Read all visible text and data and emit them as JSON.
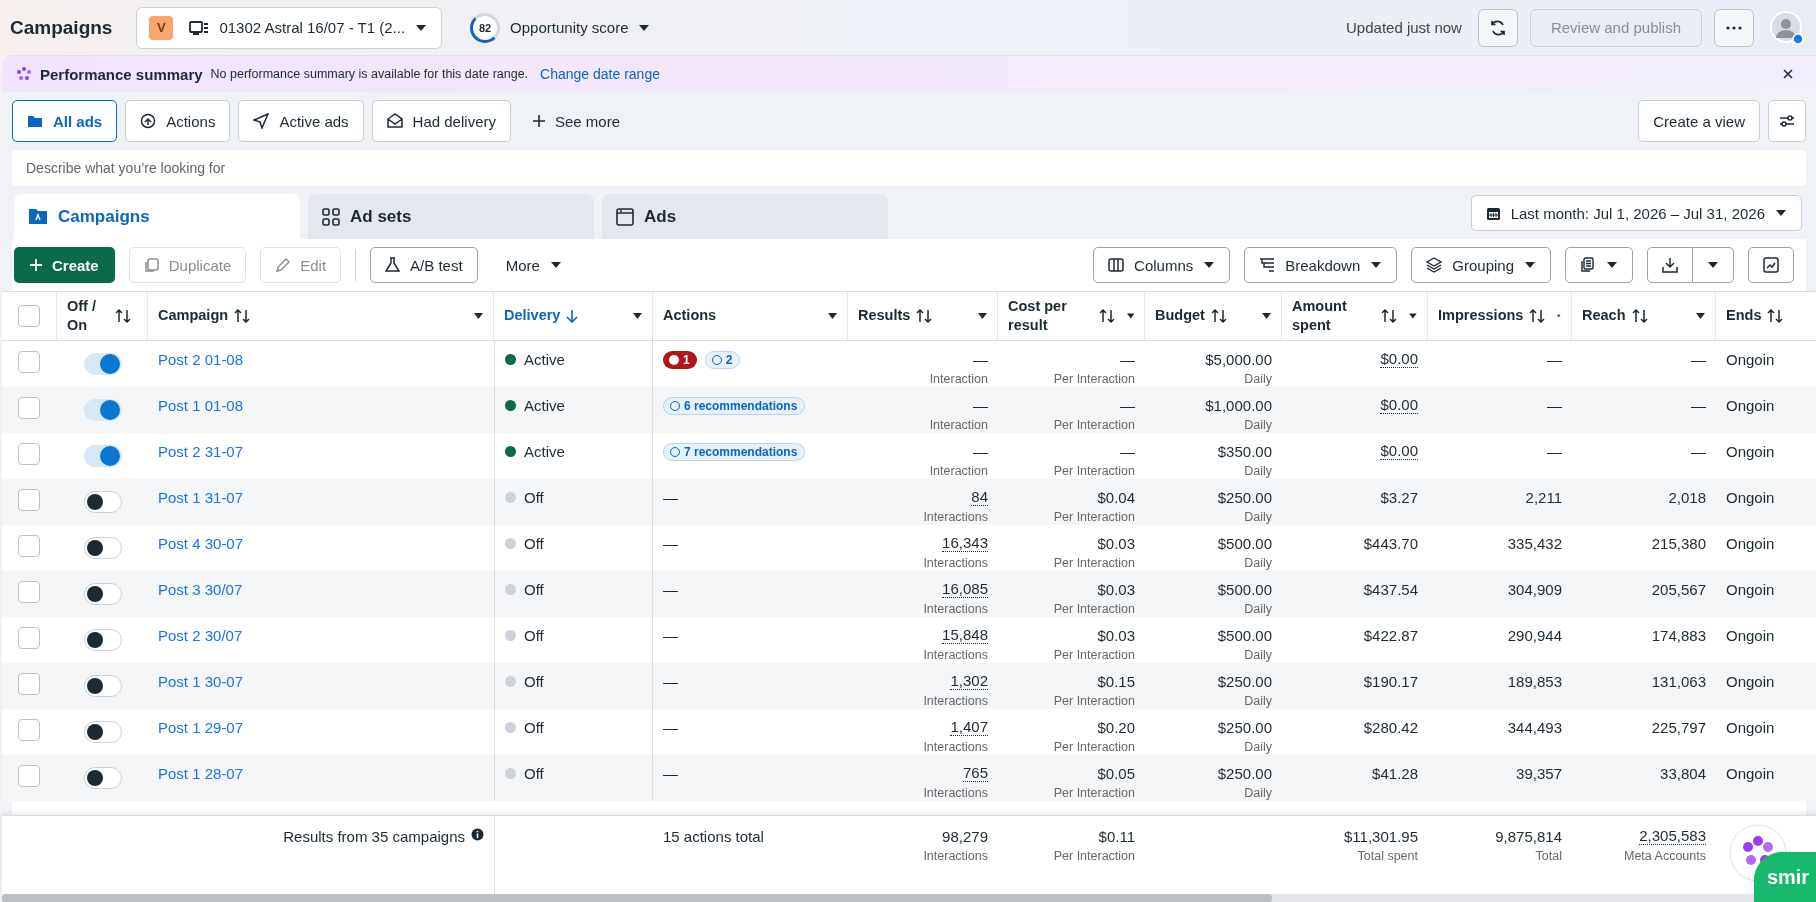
{
  "header": {
    "title": "Campaigns",
    "account": {
      "badge": "V",
      "name": "01302 Astral 16/07 - T1 (2..."
    },
    "score": {
      "value": "82",
      "label": "Opportunity score"
    },
    "status": "Updated just now",
    "publish": {
      "label": "Review and publish",
      "disabled": true
    }
  },
  "banner": {
    "title": "Performance summary",
    "message": "No performance summary is available for this date range.",
    "link": "Change date range"
  },
  "filters": [
    {
      "label": "All ads",
      "selected": true,
      "kind": "folder"
    },
    {
      "label": "Actions",
      "selected": false,
      "kind": "up"
    },
    {
      "label": "Active ads",
      "selected": false,
      "kind": "send"
    },
    {
      "label": "Had delivery",
      "selected": false,
      "kind": "mail"
    }
  ],
  "see_more": "See more",
  "create_view": "Create a view",
  "search": {
    "placeholder": "Describe what you’re looking for"
  },
  "level_tabs": [
    {
      "label": "Campaigns",
      "selected": true,
      "kind": "folder"
    },
    {
      "label": "Ad sets",
      "selected": false,
      "kind": "grid"
    },
    {
      "label": "Ads",
      "selected": false,
      "kind": "window"
    }
  ],
  "date_range": "Last month: Jul 1, 2026 – Jul 31, 2026",
  "toolbar": {
    "create": "Create",
    "duplicate": {
      "label": "Duplicate",
      "disabled": true
    },
    "edit": {
      "label": "Edit",
      "disabled": true
    },
    "ab_test": "A/B test",
    "more": "More",
    "columns": "Columns",
    "breakdown": "Breakdown",
    "grouping": "Grouping"
  },
  "table": {
    "all_checked": false,
    "columns": [
      {
        "label": "Off / On",
        "selected": false
      },
      {
        "label": "Campaign",
        "selected": false
      },
      {
        "label": "Delivery",
        "selected": true
      },
      {
        "label": "Actions",
        "selected": false
      },
      {
        "label": "Results",
        "selected": false
      },
      {
        "label": "Cost per result",
        "selected": false
      },
      {
        "label": "Budget",
        "selected": false
      },
      {
        "label": "Amount spent",
        "selected": false
      },
      {
        "label": "Impressions",
        "selected": false
      },
      {
        "label": "Reach",
        "selected": false
      },
      {
        "label": "Ends",
        "selected": false
      }
    ],
    "rows": [
      {
        "checked": false,
        "on": true,
        "name": "Post 2 01-08",
        "delivery": "Active",
        "delivery_active": true,
        "actions": [
          {
            "kind": "error",
            "text": "1"
          },
          {
            "kind": "rec",
            "text": "2"
          }
        ],
        "results": "—",
        "results_sub": "Interaction",
        "results_dotted": false,
        "cost": "—",
        "cost_sub": "Per Interaction",
        "budget": "$5,000.00",
        "budget_sub": "Daily",
        "amount": "$0.00",
        "amount_dotted": true,
        "impressions": "—",
        "reach": "—",
        "ends": "Ongoin"
      },
      {
        "checked": false,
        "on": true,
        "name": "Post 1 01-08",
        "delivery": "Active",
        "delivery_active": true,
        "actions": [
          {
            "kind": "rec",
            "text": "6 recommendations"
          }
        ],
        "results": "—",
        "results_sub": "Interaction",
        "results_dotted": false,
        "cost": "—",
        "cost_sub": "Per Interaction",
        "budget": "$1,000.00",
        "budget_sub": "Daily",
        "amount": "$0.00",
        "amount_dotted": true,
        "impressions": "—",
        "reach": "—",
        "ends": "Ongoin"
      },
      {
        "checked": false,
        "on": true,
        "name": "Post 2 31-07",
        "delivery": "Active",
        "delivery_active": true,
        "actions": [
          {
            "kind": "rec",
            "text": "7 recommendations"
          }
        ],
        "results": "—",
        "results_sub": "Interaction",
        "results_dotted": false,
        "cost": "—",
        "cost_sub": "Per Interaction",
        "budget": "$350.00",
        "budget_sub": "Daily",
        "amount": "$0.00",
        "amount_dotted": true,
        "impressions": "—",
        "reach": "—",
        "ends": "Ongoin"
      },
      {
        "checked": false,
        "on": false,
        "name": "Post 1 31-07",
        "delivery": "Off",
        "delivery_active": false,
        "actions": [
          {
            "kind": "text",
            "text": "—"
          }
        ],
        "results": "84",
        "results_sub": "Interactions",
        "results_dotted": true,
        "cost": "$0.04",
        "cost_sub": "Per Interaction",
        "budget": "$250.00",
        "budget_sub": "Daily",
        "amount": "$3.27",
        "amount_dotted": false,
        "impressions": "2,211",
        "reach": "2,018",
        "ends": "Ongoin"
      },
      {
        "checked": false,
        "on": false,
        "name": "Post 4 30-07",
        "delivery": "Off",
        "delivery_active": false,
        "actions": [
          {
            "kind": "text",
            "text": "—"
          }
        ],
        "results": "16,343",
        "results_sub": "Interactions",
        "results_dotted": true,
        "cost": "$0.03",
        "cost_sub": "Per Interaction",
        "budget": "$500.00",
        "budget_sub": "Daily",
        "amount": "$443.70",
        "amount_dotted": false,
        "impressions": "335,432",
        "reach": "215,380",
        "ends": "Ongoin"
      },
      {
        "checked": false,
        "on": false,
        "name": "Post 3 30/07",
        "delivery": "Off",
        "delivery_active": false,
        "actions": [
          {
            "kind": "text",
            "text": "—"
          }
        ],
        "results": "16,085",
        "results_sub": "Interactions",
        "results_dotted": true,
        "cost": "$0.03",
        "cost_sub": "Per Interaction",
        "budget": "$500.00",
        "budget_sub": "Daily",
        "amount": "$437.54",
        "amount_dotted": false,
        "impressions": "304,909",
        "reach": "205,567",
        "ends": "Ongoin"
      },
      {
        "checked": false,
        "on": false,
        "name": "Post 2 30/07",
        "delivery": "Off",
        "delivery_active": false,
        "actions": [
          {
            "kind": "text",
            "text": "—"
          }
        ],
        "results": "15,848",
        "results_sub": "Interactions",
        "results_dotted": true,
        "cost": "$0.03",
        "cost_sub": "Per Interaction",
        "budget": "$500.00",
        "budget_sub": "Daily",
        "amount": "$422.87",
        "amount_dotted": false,
        "impressions": "290,944",
        "reach": "174,883",
        "ends": "Ongoin"
      },
      {
        "checked": false,
        "on": false,
        "name": "Post 1 30-07",
        "delivery": "Off",
        "delivery_active": false,
        "actions": [
          {
            "kind": "text",
            "text": "—"
          }
        ],
        "results": "1,302",
        "results_sub": "Interactions",
        "results_dotted": true,
        "cost": "$0.15",
        "cost_sub": "Per Interaction",
        "budget": "$250.00",
        "budget_sub": "Daily",
        "amount": "$190.17",
        "amount_dotted": false,
        "impressions": "189,853",
        "reach": "131,063",
        "ends": "Ongoin"
      },
      {
        "checked": false,
        "on": false,
        "name": "Post 1 29-07",
        "delivery": "Off",
        "delivery_active": false,
        "actions": [
          {
            "kind": "text",
            "text": "—"
          }
        ],
        "results": "1,407",
        "results_sub": "Interactions",
        "results_dotted": true,
        "cost": "$0.20",
        "cost_sub": "Per Interaction",
        "budget": "$250.00",
        "budget_sub": "Daily",
        "amount": "$280.42",
        "amount_dotted": false,
        "impressions": "344,493",
        "reach": "225,797",
        "ends": "Ongoin"
      },
      {
        "checked": false,
        "on": false,
        "name": "Post 1 28-07",
        "delivery": "Off",
        "delivery_active": false,
        "actions": [
          {
            "kind": "text",
            "text": "—"
          }
        ],
        "results": "765",
        "results_sub": "Interactions",
        "results_dotted": true,
        "cost": "$0.05",
        "cost_sub": "Per Interaction",
        "budget": "$250.00",
        "budget_sub": "Daily",
        "amount": "$41.28",
        "amount_dotted": false,
        "impressions": "39,357",
        "reach": "33,804",
        "ends": "Ongoin"
      }
    ],
    "footer": {
      "label": "Results from 35 campaigns",
      "actions": "15 actions total",
      "results": {
        "value": "98,279",
        "sub": "Interactions"
      },
      "cost": {
        "value": "$0.11",
        "sub": "Per Interaction"
      },
      "amount": {
        "value": "$11,301.95",
        "sub": "Total spent"
      },
      "impressions": {
        "value": "9,875,814",
        "sub": "Total"
      },
      "reach": {
        "value": "2,305,583",
        "sub": "Meta Accounts"
      }
    }
  },
  "floating_badge": "smir"
}
